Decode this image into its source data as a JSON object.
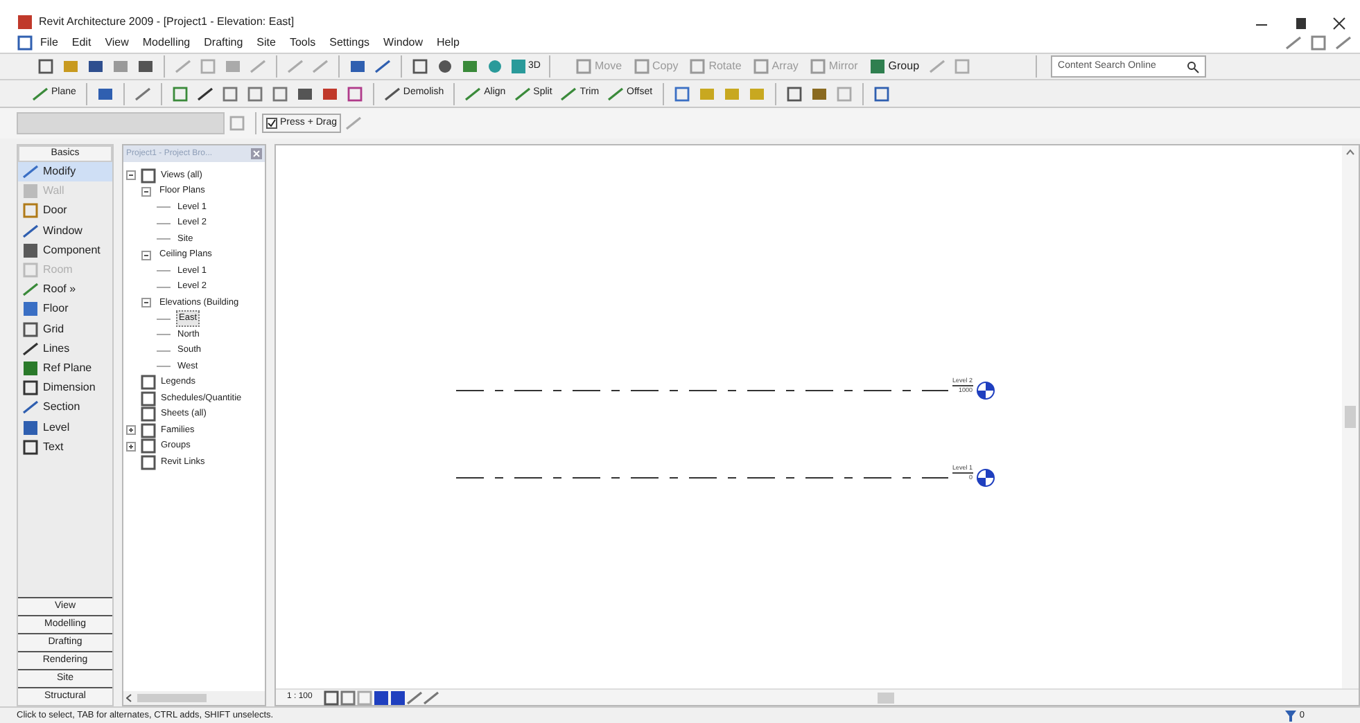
{
  "window": {
    "title": "Revit Architecture 2009 - [Project1 - Elevation: East]"
  },
  "menu": [
    "File",
    "Edit",
    "View",
    "Modelling",
    "Drafting",
    "Site",
    "Tools",
    "Settings",
    "Window",
    "Help"
  ],
  "toolbar_edit": [
    {
      "label": "Move"
    },
    {
      "label": "Copy"
    },
    {
      "label": "Rotate"
    },
    {
      "label": "Array"
    },
    {
      "label": "Mirror"
    },
    {
      "label": "Group"
    }
  ],
  "toolbar_view": {
    "label": "3D"
  },
  "search": {
    "placeholder": "Content Search Online"
  },
  "toolbar_tools": [
    {
      "label": "Plane"
    },
    {
      "label": "Demolish"
    },
    {
      "label": "Align"
    },
    {
      "label": "Split"
    },
    {
      "label": "Trim"
    },
    {
      "label": "Offset"
    }
  ],
  "options_bar": {
    "press_drag": {
      "label": "Press + Drag",
      "checked": true
    }
  },
  "design_bar": {
    "title": "Basics",
    "items": [
      {
        "label": "Modify",
        "selected": true,
        "disabled": false
      },
      {
        "label": "Wall",
        "selected": false,
        "disabled": true
      },
      {
        "label": "Door",
        "selected": false,
        "disabled": false
      },
      {
        "label": "Window",
        "selected": false,
        "disabled": false
      },
      {
        "label": "Component",
        "selected": false,
        "disabled": false
      },
      {
        "label": "Room",
        "selected": false,
        "disabled": true
      },
      {
        "label": "Roof »",
        "selected": false,
        "disabled": false
      },
      {
        "label": "Floor",
        "selected": false,
        "disabled": false
      },
      {
        "label": "Grid",
        "selected": false,
        "disabled": false
      },
      {
        "label": "Lines",
        "selected": false,
        "disabled": false
      },
      {
        "label": "Ref Plane",
        "selected": false,
        "disabled": false
      },
      {
        "label": "Dimension",
        "selected": false,
        "disabled": false
      },
      {
        "label": "Section",
        "selected": false,
        "disabled": false
      },
      {
        "label": "Level",
        "selected": false,
        "disabled": false
      },
      {
        "label": "Text",
        "selected": false,
        "disabled": false
      }
    ],
    "tabs": [
      "View",
      "Modelling",
      "Drafting",
      "Rendering",
      "Site",
      "Structural"
    ]
  },
  "project_browser": {
    "title": "Project1 - Project Bro...",
    "tree": [
      {
        "label": "Views (all)",
        "expanded": true,
        "selected": false,
        "children": [
          {
            "label": "Floor Plans",
            "expanded": true,
            "selected": false,
            "children": [
              {
                "label": "Level 1",
                "selected": false
              },
              {
                "label": "Level 2",
                "selected": false
              },
              {
                "label": "Site",
                "selected": false
              }
            ]
          },
          {
            "label": "Ceiling Plans",
            "expanded": true,
            "selected": false,
            "children": [
              {
                "label": "Level 1",
                "selected": false
              },
              {
                "label": "Level 2",
                "selected": false
              }
            ]
          },
          {
            "label": "Elevations (Building",
            "expanded": true,
            "selected": false,
            "children": [
              {
                "label": "East",
                "selected": true
              },
              {
                "label": "North",
                "selected": false
              },
              {
                "label": "South",
                "selected": false
              },
              {
                "label": "West",
                "selected": false
              }
            ]
          }
        ]
      },
      {
        "label": "Legends",
        "selected": false
      },
      {
        "label": "Schedules/Quantitie",
        "selected": false
      },
      {
        "label": "Sheets (all)",
        "selected": false
      },
      {
        "label": "Families",
        "expanded": false,
        "selected": false
      },
      {
        "label": "Groups",
        "expanded": false,
        "selected": false
      },
      {
        "label": "Revit Links",
        "selected": false
      }
    ]
  },
  "levels": [
    {
      "name": "Level 2",
      "elevation": "1000"
    },
    {
      "name": "Level 1",
      "elevation": "0"
    }
  ],
  "view_control": {
    "scale": "1 : 100"
  },
  "status_bar": {
    "message": "Click to select, TAB for alternates, CTRL adds, SHIFT unselects.",
    "filter_count": "0"
  }
}
